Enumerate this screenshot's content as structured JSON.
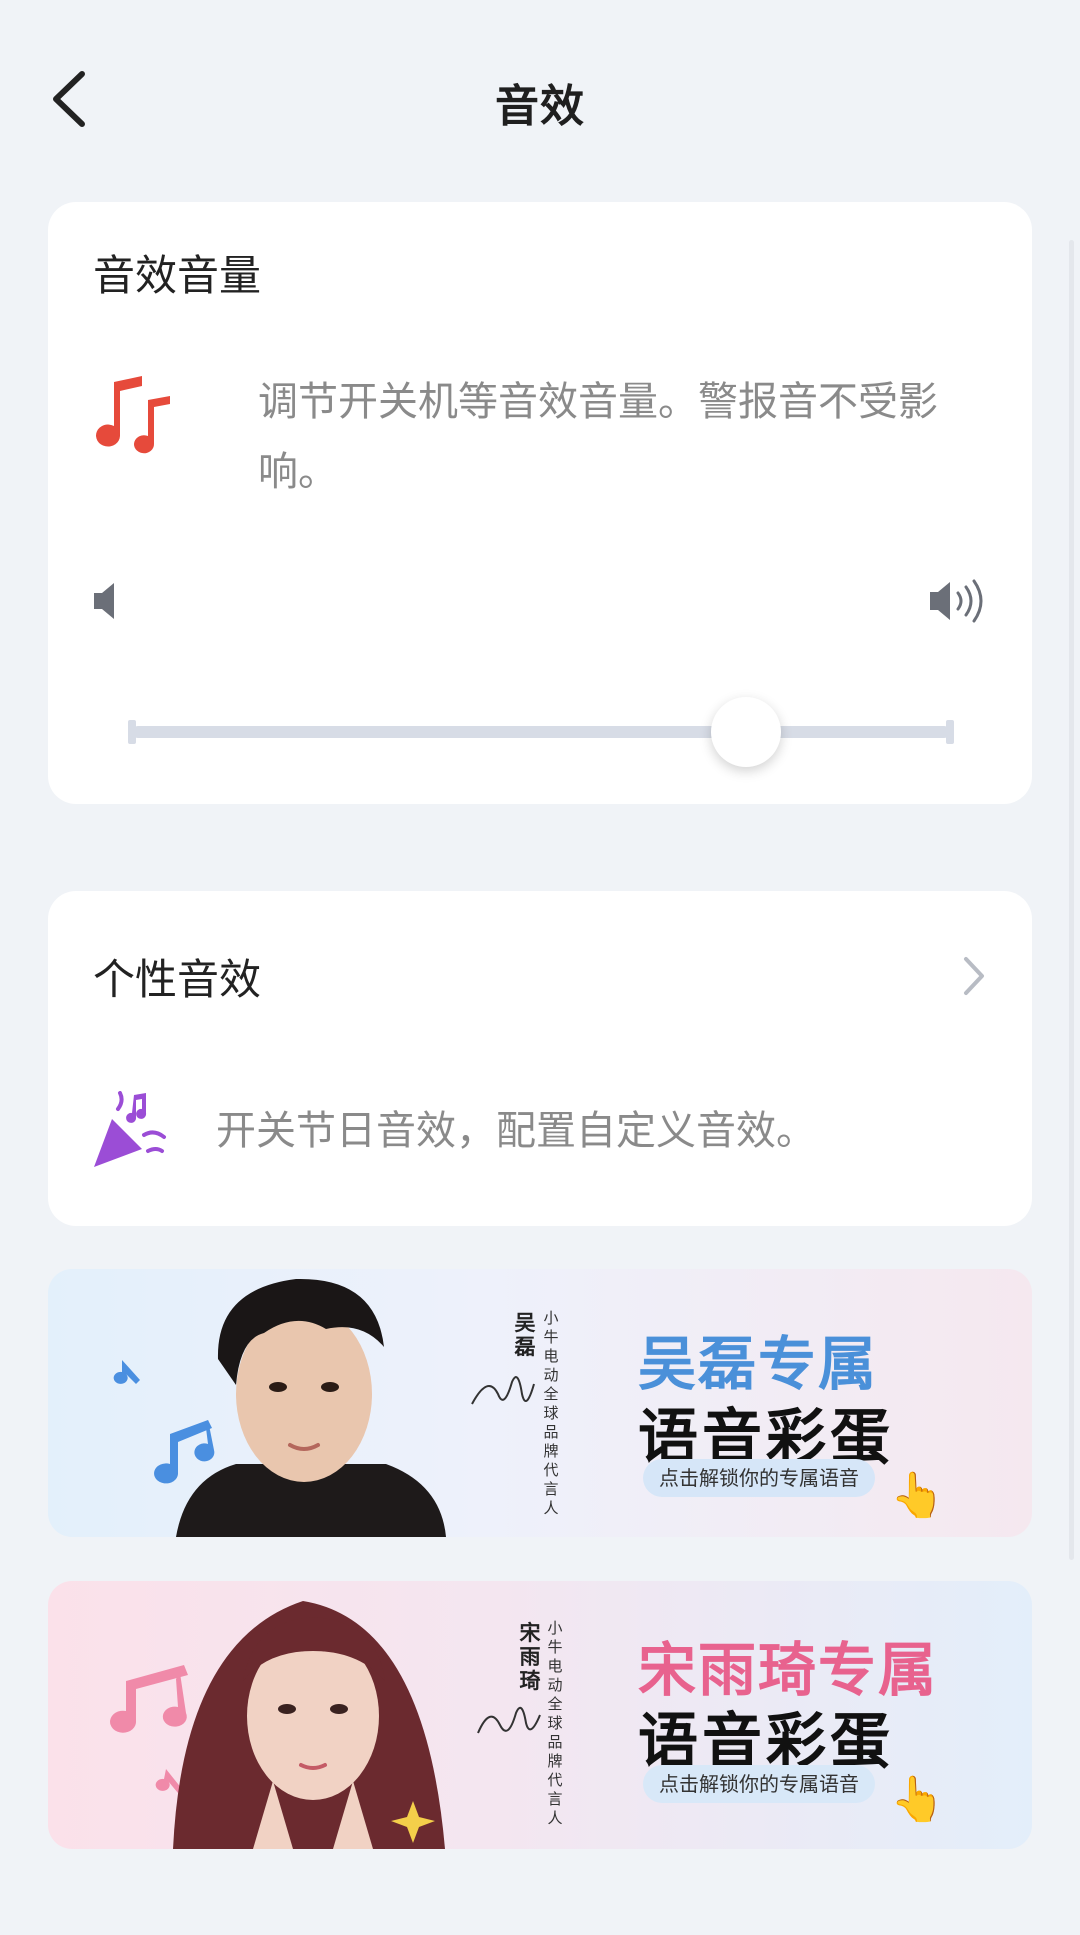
{
  "header": {
    "title": "音效"
  },
  "volume_card": {
    "title": "音效音量",
    "description": "调节开关机等音效音量。警报音不受影响。",
    "slider_value": 0.75,
    "icon": "music-notes-icon"
  },
  "personal_card": {
    "title": "个性音效",
    "description": "开关节日音效，配置自定义音效。",
    "icon": "party-popper-icon"
  },
  "banners": [
    {
      "name": "吴磊",
      "role": "小牛电动全球品牌代言人",
      "headline": "吴磊专属",
      "subline": "语音彩蛋",
      "cta": "点击解锁你的专属语音",
      "accent": "#4a90d9"
    },
    {
      "name": "宋雨琦",
      "role": "小牛电动全球品牌代言人",
      "headline": "宋雨琦专属",
      "subline": "语音彩蛋",
      "cta": "点击解锁你的专属语音",
      "accent": "#e8628e"
    }
  ],
  "colors": {
    "background": "#f0f3f7",
    "card": "#ffffff",
    "track": "#d7dce6"
  }
}
